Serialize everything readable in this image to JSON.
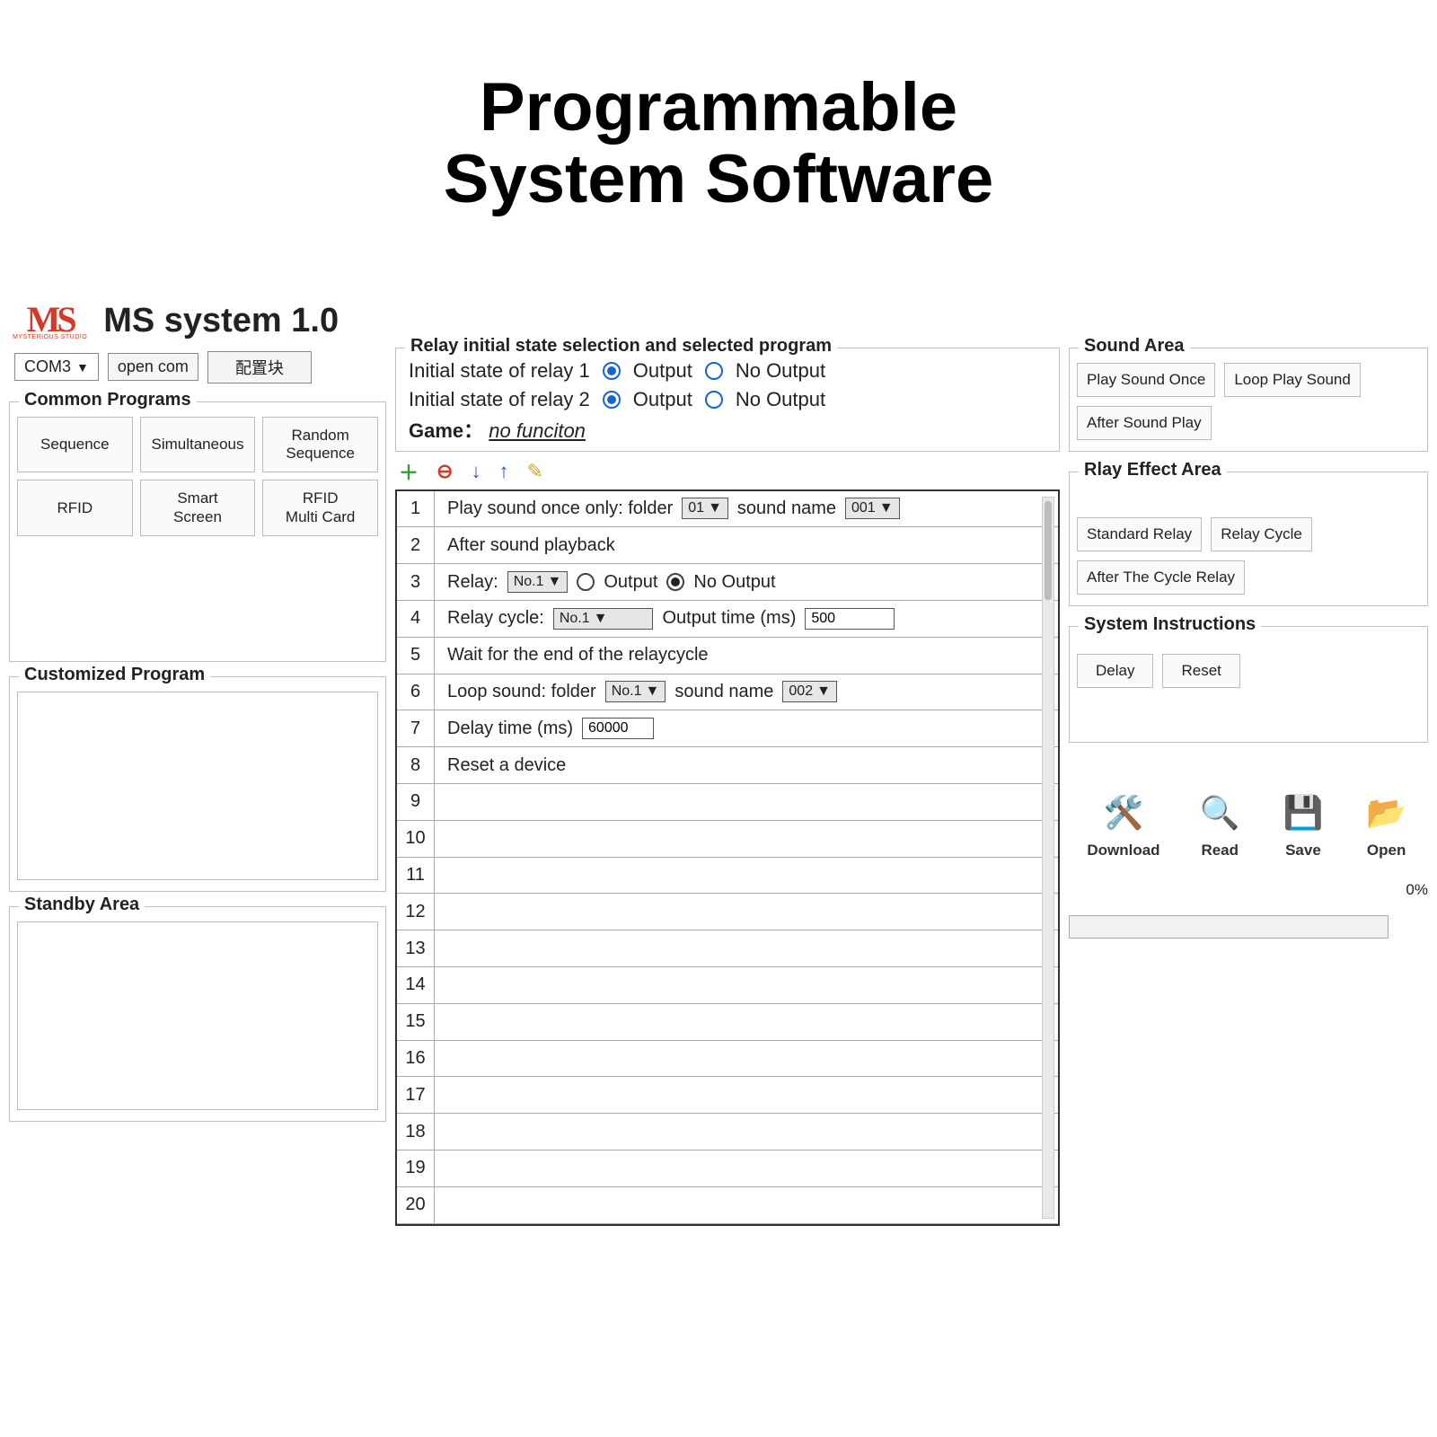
{
  "hero": {
    "line1": "Programmable",
    "line2": "System Software"
  },
  "app_title": "MS system 1.0",
  "logo_sub": "MYSTERIOUS STUDIO",
  "com_port": "COM3",
  "open_com_btn": "open com",
  "config_btn": "配置块",
  "common_programs": {
    "title": "Common Programs",
    "items": [
      "Sequence",
      "Simultaneous",
      "Random\nSequence",
      "RFID",
      "Smart\nScreen",
      "RFID\nMulti Card"
    ]
  },
  "customized": {
    "title": "Customized Program"
  },
  "standby": {
    "title": "Standby Area"
  },
  "relay_header": {
    "title": "Relay initial state selection and selected program",
    "row1_label": "Initial state of relay 1",
    "row2_label": "Initial state of relay 2",
    "opt_output": "Output",
    "opt_no_output": "No Output",
    "game_label": "Game：",
    "game_value": "no funciton"
  },
  "steps": {
    "s1_a": "Play sound once only: folder",
    "s1_folder": "01",
    "s1_b": "sound name",
    "s1_name": "001",
    "s2": "After sound playback",
    "s3_a": "Relay:",
    "s3_sel": "No.1",
    "s3_opt1": "Output",
    "s3_opt2": "No Output",
    "s4_a": "Relay cycle:",
    "s4_sel": "No.1",
    "s4_b": "Output time (ms)",
    "s4_val": "500",
    "s5": "Wait for the end of the relaycycle",
    "s6_a": "Loop sound: folder",
    "s6_sel": "No.1",
    "s6_b": "sound name",
    "s6_name": "002",
    "s7_a": "Delay time (ms)",
    "s7_val": "60000",
    "s8": "Reset a device"
  },
  "sound_area": {
    "title": "Sound Area",
    "btns": [
      "Play Sound Once",
      "Loop Play Sound",
      "After Sound Play"
    ]
  },
  "relay_effect": {
    "title": "Rlay Effect Area",
    "btns": [
      "Standard Relay",
      "Relay Cycle",
      "After The Cycle Relay"
    ]
  },
  "sys_instr": {
    "title": "System Instructions",
    "btns": [
      "Delay",
      "Reset"
    ]
  },
  "actions": {
    "download": "Download",
    "read": "Read",
    "save": "Save",
    "open": "Open"
  },
  "progress": "0%"
}
